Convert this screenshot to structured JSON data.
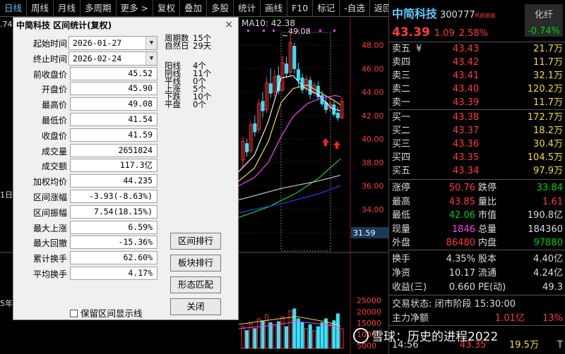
{
  "toolbar": {
    "items": [
      "日线",
      "周线",
      "月线",
      "多周期",
      "更多 >",
      "复权",
      "叠加",
      "多股",
      "统计",
      "画线",
      "F10",
      "标记",
      "-自选",
      "返回"
    ]
  },
  "chart": {
    "ma_label": "MA10: 42.38",
    "peak_label": "49.08",
    "price_ticks": [
      "48.00",
      "46.00",
      "44.00",
      "42.00",
      "40.00",
      "38.00",
      "36.00",
      "34.00",
      "32.00"
    ],
    "price_tag": "31.59",
    "vol_ticks": [
      "25000",
      "20000",
      "15000",
      "10000",
      "5000"
    ],
    "left_edge": {
      "a": ".74",
      "b": "1日",
      "c": "5年"
    },
    "colors": {
      "candle_up": "#ff3030",
      "candle_down": "#38e0ff",
      "ma5": "#f0f0f0",
      "ma10": "#f3dc3a",
      "ma20": "#ff40ff",
      "ma60": "#20d020",
      "ma120": "#c8c8c8",
      "ma250": "#2040ff"
    }
  },
  "dialog": {
    "title": "中简科技 区间统计(复权)",
    "fields": [
      {
        "label": "起始时间",
        "value": "2026-01-27"
      },
      {
        "label": "终止时间",
        "value": "2026-02-24"
      },
      {
        "label": "前收盘价",
        "value": "45.52"
      },
      {
        "label": "开盘价",
        "value": "45.90"
      },
      {
        "label": "最高价",
        "value": "49.08"
      },
      {
        "label": "最低价",
        "value": "41.54"
      },
      {
        "label": "收盘价",
        "value": "41.59"
      },
      {
        "label": "成交量",
        "value": "2651824"
      },
      {
        "label": "成交额",
        "value": "117.3亿"
      },
      {
        "label": "加权均价",
        "value": "44.235"
      },
      {
        "label": "区间涨幅",
        "value": "-3.93(-8.63%)"
      },
      {
        "label": "区间振幅",
        "value": "7.54(18.15%)"
      },
      {
        "label": "最大上涨",
        "value": "6.59%"
      },
      {
        "label": "最大回撤",
        "value": "-15.36%"
      },
      {
        "label": "累计换手",
        "value": "62.60%"
      },
      {
        "label": "平均换手",
        "value": "4.17%"
      }
    ],
    "period_counts": [
      {
        "k": "周期数",
        "v": "15个"
      },
      {
        "k": "自然日",
        "v": "29天"
      }
    ],
    "bar_counts": [
      {
        "k": "阳线",
        "v": "4个"
      },
      {
        "k": "阴线",
        "v": "11个"
      },
      {
        "k": "平线",
        "v": "0个"
      },
      {
        "k": "上涨",
        "v": "5个"
      },
      {
        "k": "下跌",
        "v": "10个"
      },
      {
        "k": "平盘",
        "v": "0个"
      }
    ],
    "buttons": [
      "区间排行",
      "板块排行",
      "形态匹配",
      "关闭"
    ],
    "checkbox": "保留区间显示线",
    "close": "×"
  },
  "quote": {
    "name": "中简科技",
    "code": "300777",
    "tag": "R⊞⊞⊞",
    "price": "43.39",
    "change": "1.09",
    "pct": "2.58%",
    "sector": {
      "name": "化纤",
      "pct": "-0.74%"
    },
    "asks": [
      {
        "label": "卖五",
        "mark": "¥",
        "price": "43.43",
        "vol": "21.7万"
      },
      {
        "label": "卖四",
        "mark": "",
        "price": "43.42",
        "vol": "11.7万"
      },
      {
        "label": "卖三",
        "mark": "",
        "price": "43.41",
        "vol": "32.1万"
      },
      {
        "label": "卖二",
        "mark": "",
        "price": "43.40",
        "vol": "120.2万"
      },
      {
        "label": "卖一",
        "mark": "",
        "price": "43.39",
        "vol": "11.7万"
      }
    ],
    "bids": [
      {
        "label": "买一",
        "price": "43.38",
        "vol": "172.7万"
      },
      {
        "label": "买二",
        "price": "43.37",
        "vol": "18.2万"
      },
      {
        "label": "买三",
        "price": "43.36",
        "vol": "30.4万"
      },
      {
        "label": "买四",
        "price": "43.35",
        "vol": "104.5万"
      },
      {
        "label": "买五",
        "price": "43.34",
        "vol": "97.9万"
      }
    ],
    "stats": [
      {
        "k1": "涨停",
        "v1": "50.76",
        "c1": "#ff3b3b",
        "k2": "跌停",
        "v2": "33.84",
        "c2": "#00d000"
      },
      {
        "k1": "最高",
        "v1": "43.85",
        "c1": "#ff3b3b",
        "k2": "量比",
        "v2": "1.61",
        "c2": "#ff3b3b"
      },
      {
        "k1": "最低",
        "v1": "42.06",
        "c1": "#00d000",
        "k2": "市值",
        "v2": "190.8亿",
        "c2": "#dcdcdc"
      },
      {
        "k1": "现量",
        "v1": "1846",
        "c1": "#ff40ff",
        "k2": "总量",
        "v2": "184360",
        "c2": "#dcdcdc"
      },
      {
        "k1": "外盘",
        "v1": "86480",
        "c1": "#ff3b3b",
        "k2": "内盘",
        "v2": "97880",
        "c2": "#00d000"
      }
    ],
    "stats2": [
      {
        "k1": "换手",
        "v1": "4.35%",
        "k2": "股本",
        "v2": "4.40亿"
      },
      {
        "k1": "净资",
        "v1": "10.17",
        "k2": "流通",
        "v2": "4.24亿"
      },
      {
        "k1": "收益(三)",
        "v1": "0.660",
        "k2": "PE(动)",
        "v2": "49.3"
      }
    ],
    "status": "交易状态: 闭市阶段 15:30:00",
    "fund": {
      "label": "主力净额",
      "value": "1.01亿",
      "pct": "13%"
    },
    "tick": {
      "time": "14:56",
      "price": "43.35",
      "vol": "19.5万",
      "flag": "T"
    }
  },
  "watermark": "雪球：历史的进程2022"
}
